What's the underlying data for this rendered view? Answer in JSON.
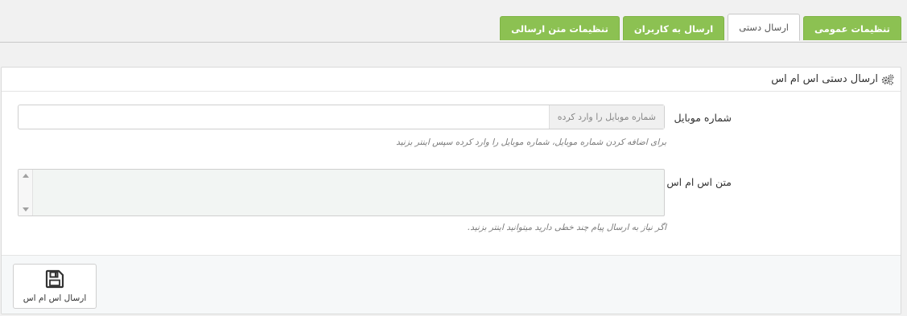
{
  "tabs": [
    {
      "label": "تنظیمات عمومی",
      "active": false
    },
    {
      "label": "ارسال دستی",
      "active": true
    },
    {
      "label": "ارسال به کاربران",
      "active": false
    },
    {
      "label": "تنظیمات متن ارسالی",
      "active": false
    }
  ],
  "colors": {
    "tab_green": "#8cc152",
    "panel_border": "#dadada",
    "page_background": "#f1f1f1"
  },
  "panel": {
    "title": "ارسال دستی اس ام اس",
    "title_icon": "gears-icon"
  },
  "mobile": {
    "label": "شماره موبایل",
    "placeholder": "شماره موبایل را وارد کرده",
    "value": "",
    "help": "برای اضافه کردن شماره موبایل، شماره موبایل را وارد کرده سپس اینتر بزنید"
  },
  "sms": {
    "label": "متن اس ام اس",
    "value": "",
    "help": "اگر نیاز به ارسال پیام چند خطی دارید میتوانید اینتر بزنید."
  },
  "footer": {
    "send_label": "ارسال اس ام اس",
    "send_icon": "save-icon"
  }
}
